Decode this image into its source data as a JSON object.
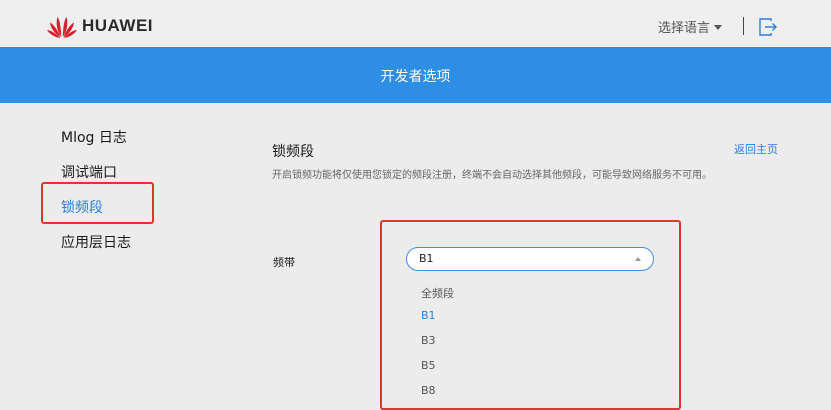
{
  "header": {
    "brand": "HUAWEI",
    "language_label": "选择语言",
    "logo_icon": "huawei-petal-logo",
    "logout_icon": "logout-icon",
    "brand_color": "#d8202c"
  },
  "banner": {
    "title": "开发者选项",
    "color": "#2d8ee3"
  },
  "sidebar": {
    "items": [
      {
        "label": "Mlog 日志"
      },
      {
        "label": "调试端口"
      },
      {
        "label": "锁频段"
      },
      {
        "label": "应用层日志"
      }
    ]
  },
  "main": {
    "title": "锁频段",
    "back_link": "返回主页",
    "description": "开启锁频功能将仅使用您锁定的频段注册，终端不会自动选择其他频段，可能导致网络服务不可用。",
    "band_label": "频带",
    "band_select": {
      "value": "B1",
      "options": [
        "全频段",
        "B1",
        "B3",
        "B5",
        "B8"
      ]
    }
  },
  "accent_color": "#2d7fd8",
  "highlight_color": "#e0362c"
}
